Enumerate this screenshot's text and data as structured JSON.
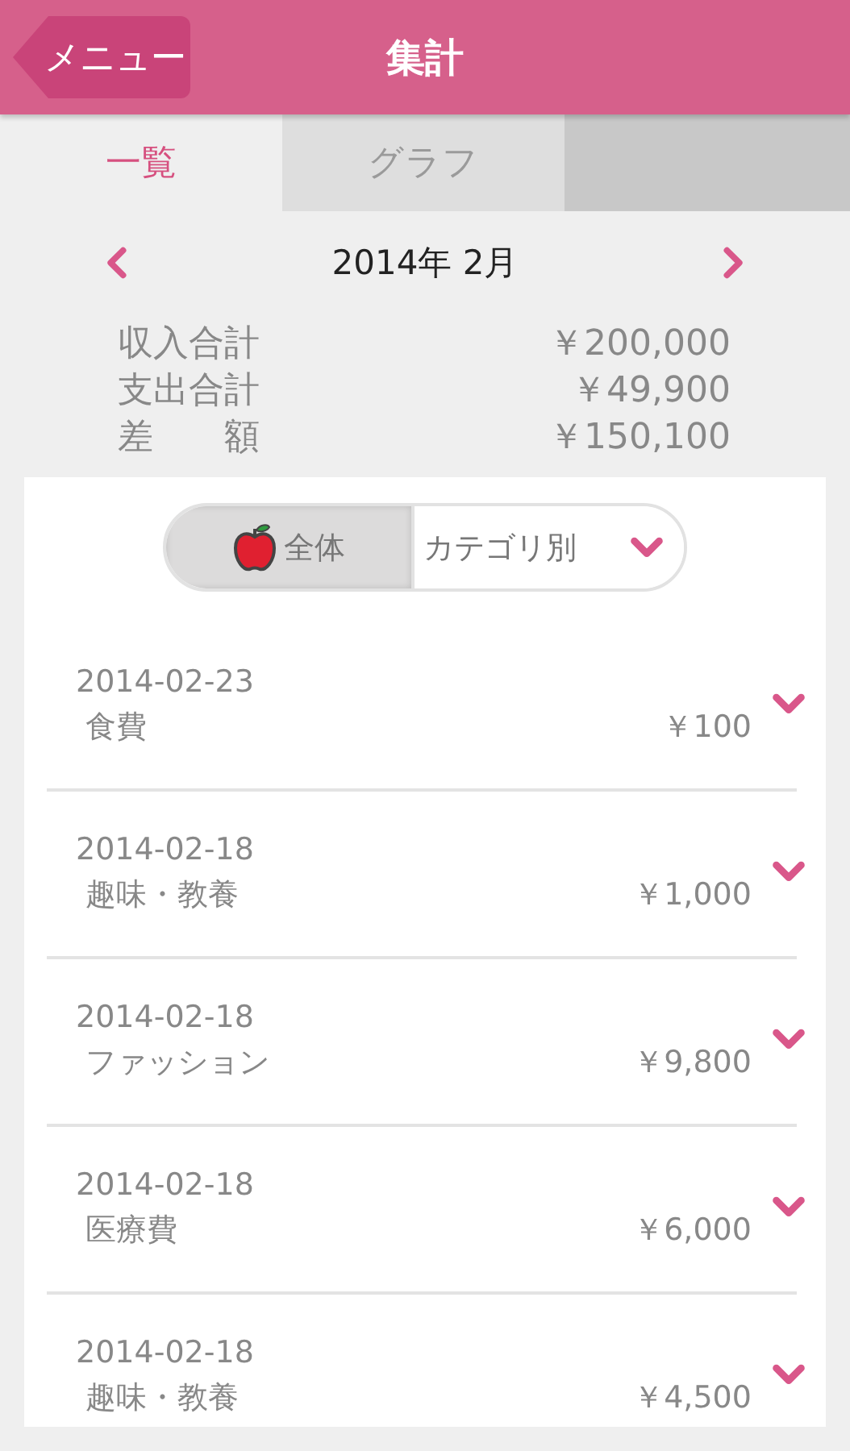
{
  "header": {
    "back_button": "メニュー",
    "title": "集計"
  },
  "tabs": [
    {
      "label": "一覧",
      "selected": true
    },
    {
      "label": "グラフ",
      "selected": false
    }
  ],
  "month": {
    "label": "2014年 2月"
  },
  "summary": [
    {
      "label": "収入合計",
      "value": "￥200,000"
    },
    {
      "label": "支出合計",
      "value": "￥49,900"
    },
    {
      "label": "差　　額",
      "value": "￥150,100"
    }
  ],
  "filter": [
    {
      "label": "全体",
      "kind": "all",
      "selected": true
    },
    {
      "label": "カテゴリ別",
      "kind": "dropdown",
      "selected": false
    }
  ],
  "entries": [
    {
      "date": "2014-02-23",
      "category": "食費",
      "amount": "￥100"
    },
    {
      "date": "2014-02-18",
      "category": "趣味・教養",
      "amount": "￥1,000"
    },
    {
      "date": "2014-02-18",
      "category": "ファッション",
      "amount": "￥9,800"
    },
    {
      "date": "2014-02-18",
      "category": "医療費",
      "amount": "￥6,000"
    },
    {
      "date": "2014-02-18",
      "category": "趣味・教養",
      "amount": "￥4,500"
    }
  ]
}
